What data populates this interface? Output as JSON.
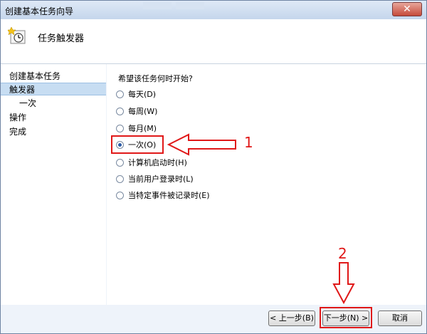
{
  "window": {
    "title": "创建基本任务向导",
    "close_label": "✕"
  },
  "header": {
    "title": "任务触发器"
  },
  "nav": {
    "items": [
      {
        "label": "创建基本任务"
      },
      {
        "label": "触发器"
      },
      {
        "label": "一次"
      },
      {
        "label": "操作"
      },
      {
        "label": "完成"
      }
    ]
  },
  "content": {
    "question": "希望该任务何时开始?",
    "options": [
      {
        "label": "每天(D)",
        "checked": false
      },
      {
        "label": "每周(W)",
        "checked": false
      },
      {
        "label": "每月(M)",
        "checked": false
      },
      {
        "label": "一次(O)",
        "checked": true
      },
      {
        "label": "计算机启动时(H)",
        "checked": false
      },
      {
        "label": "当前用户登录时(L)",
        "checked": false
      },
      {
        "label": "当特定事件被记录时(E)",
        "checked": false
      }
    ]
  },
  "annotations": {
    "num1": "1",
    "num2": "2",
    "color": "#e01818"
  },
  "buttons": {
    "back": "< 上一步(B)",
    "next": "下一步(N) >",
    "cancel": "取消"
  }
}
